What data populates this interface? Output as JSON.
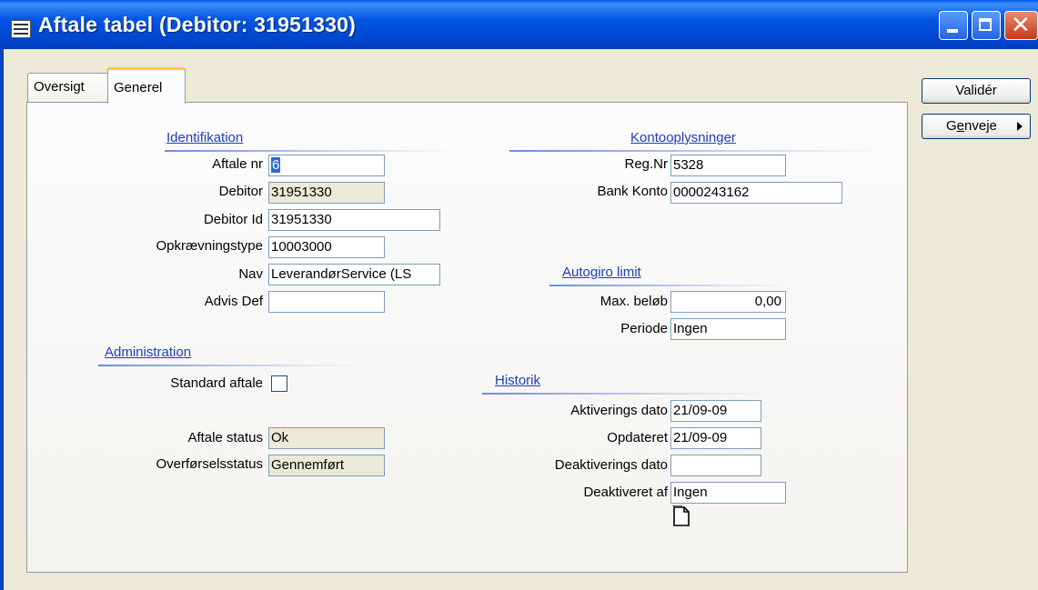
{
  "window": {
    "title": "Aftale tabel (Debitor: 31951330)"
  },
  "buttons": {
    "validate": "Validér",
    "shortcuts_pre": "G",
    "shortcuts_u": "e",
    "shortcuts_post": "nveje"
  },
  "tabs": [
    "Oversigt",
    "Generel"
  ],
  "identification": {
    "heading": "Identifikation",
    "agreement_no_label": "Aftale nr",
    "agreement_no": "6",
    "debtor_label": "Debitor",
    "debtor": "31951330",
    "debtor_id_label": "Debitor Id",
    "debtor_id": "31951330",
    "collection_type_label": "Opkrævningstype",
    "collection_type": "10003000",
    "name_label": "Nav",
    "name": "LeverandørService (LS",
    "advis_label": "Advis Def",
    "advis": ""
  },
  "administration": {
    "heading": "Administration",
    "standard_label": "Standard aftale",
    "standard_checked": false,
    "status_label": "Aftale status",
    "status": "Ok",
    "transfer_label": "Overførselsstatus",
    "transfer": "Gennemført"
  },
  "account": {
    "heading": "Kontooplysninger",
    "reg_label": "Reg.Nr",
    "reg": "5328",
    "bank_label": "Bank Konto",
    "bank": "0000243162"
  },
  "autogiro": {
    "heading": "Autogiro limit",
    "max_label": "Max. beløb",
    "max": "0,00",
    "period_label": "Periode",
    "period": "Ingen"
  },
  "history": {
    "heading": "Historik",
    "activation_label": "Aktiverings dato",
    "activation": "21/09-09",
    "updated_label": "Opdateret",
    "updated": "21/09-09",
    "deactivation_label": "Deaktiverings dato",
    "deactivation": "",
    "deactivated_by_label": "Deaktiveret af",
    "deactivated_by": "Ingen"
  },
  "colors": {
    "titlebar": "#0054E3",
    "section_heading": "#1E3DBF",
    "selection": "#316AC5",
    "tab_highlight": "#FFC83C"
  }
}
